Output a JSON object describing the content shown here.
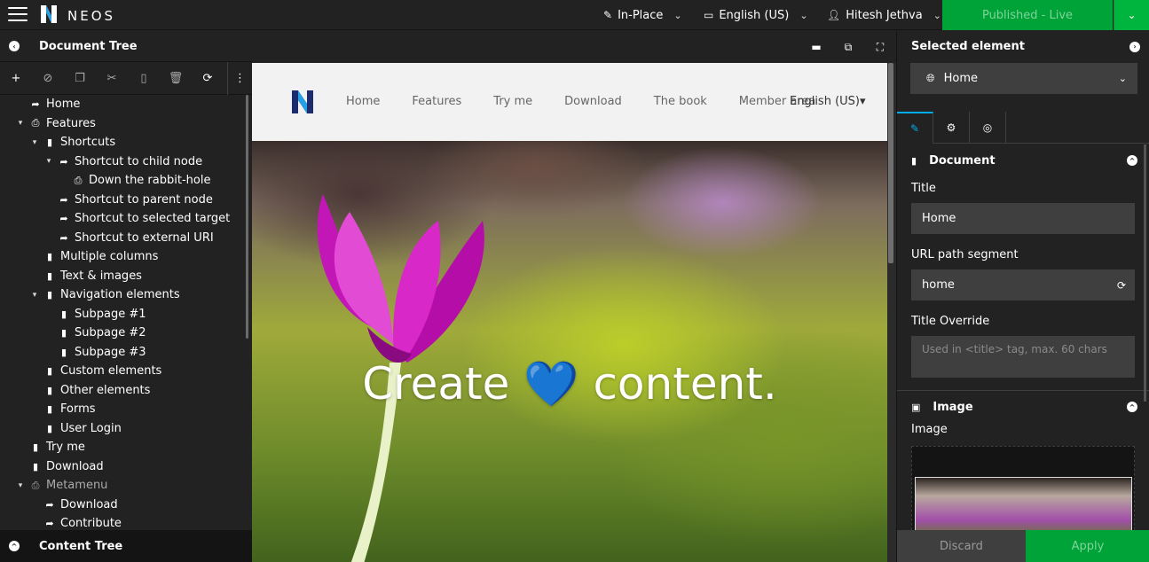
{
  "app": {
    "brand": "NEOS"
  },
  "topbar": {
    "edit_mode": "In-Place",
    "dimension": "English (US)",
    "user": "Hitesh Jethva",
    "publish_status": "Published - Live",
    "colors": {
      "published": "#00a338",
      "accent": "#00adee"
    }
  },
  "document_tree": {
    "title": "Document Tree",
    "toolbar": [
      "add-icon",
      "hide-icon",
      "copy-icon",
      "cut-icon",
      "paste-icon",
      "delete-icon",
      "refresh-icon",
      "more-icon"
    ],
    "nodes": [
      {
        "label": "Home",
        "depth": 0,
        "icon": "shortcut",
        "caret": ""
      },
      {
        "label": "Features",
        "depth": 0,
        "icon": "doc-shortcut",
        "caret": "open"
      },
      {
        "label": "Shortcuts",
        "depth": 1,
        "icon": "page",
        "caret": "open"
      },
      {
        "label": "Shortcut to child node",
        "depth": 2,
        "icon": "shortcut",
        "caret": "open"
      },
      {
        "label": "Down the rabbit-hole",
        "depth": 3,
        "icon": "doc-shortcut",
        "caret": ""
      },
      {
        "label": "Shortcut to parent node",
        "depth": 2,
        "icon": "shortcut",
        "caret": ""
      },
      {
        "label": "Shortcut to selected target",
        "depth": 2,
        "icon": "shortcut",
        "caret": ""
      },
      {
        "label": "Shortcut to external URI",
        "depth": 2,
        "icon": "shortcut",
        "caret": ""
      },
      {
        "label": "Multiple columns",
        "depth": 1,
        "icon": "page",
        "caret": ""
      },
      {
        "label": "Text & images",
        "depth": 1,
        "icon": "page",
        "caret": ""
      },
      {
        "label": "Navigation elements",
        "depth": 1,
        "icon": "page",
        "caret": "open"
      },
      {
        "label": "Subpage #1",
        "depth": 2,
        "icon": "page",
        "caret": ""
      },
      {
        "label": "Subpage #2",
        "depth": 2,
        "icon": "page",
        "caret": ""
      },
      {
        "label": "Subpage #3",
        "depth": 2,
        "icon": "page",
        "caret": ""
      },
      {
        "label": "Custom elements",
        "depth": 1,
        "icon": "page",
        "caret": ""
      },
      {
        "label": "Other elements",
        "depth": 1,
        "icon": "page",
        "caret": ""
      },
      {
        "label": "Forms",
        "depth": 1,
        "icon": "page",
        "caret": ""
      },
      {
        "label": "User Login",
        "depth": 1,
        "icon": "page",
        "caret": ""
      },
      {
        "label": "Try me",
        "depth": 0,
        "icon": "page",
        "caret": ""
      },
      {
        "label": "Download",
        "depth": 0,
        "icon": "page",
        "caret": ""
      },
      {
        "label": "Metamenu",
        "depth": 0,
        "icon": "doc-shortcut",
        "caret": "open",
        "muted": true
      },
      {
        "label": "Download",
        "depth": 1,
        "icon": "shortcut",
        "caret": ""
      },
      {
        "label": "Contribute",
        "depth": 1,
        "icon": "shortcut",
        "caret": ""
      }
    ]
  },
  "content_tree": {
    "title": "Content Tree"
  },
  "site": {
    "nav": [
      "Home",
      "Features",
      "Try me",
      "Download",
      "The book",
      "Member area"
    ],
    "language": "English (US)▾",
    "hero_title_before": "Create",
    "hero_emoji": "💙",
    "hero_title_after": "content."
  },
  "inspector": {
    "title": "Selected element",
    "node": "Home",
    "tabs": [
      "pencil-icon",
      "gear-icon",
      "target-icon"
    ],
    "document_group": {
      "title": "Document",
      "title_label": "Title",
      "title_value": "Home",
      "uri_label": "URL path segment",
      "uri_value": "home",
      "override_label": "Title Override",
      "override_placeholder": "Used in <title> tag, max. 60 chars"
    },
    "image_group": {
      "title": "Image",
      "image_label": "Image"
    },
    "discard": "Discard",
    "apply": "Apply"
  }
}
